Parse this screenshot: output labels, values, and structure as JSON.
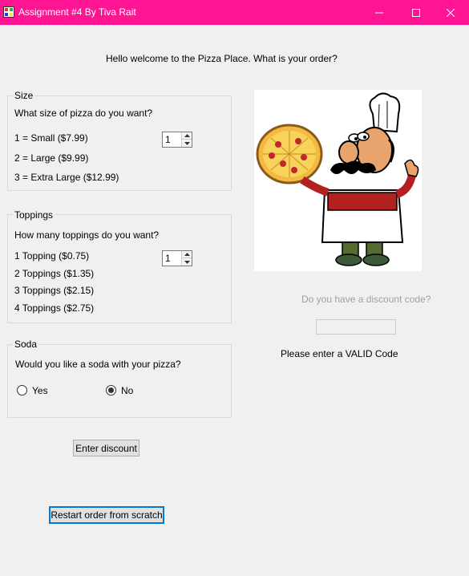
{
  "window": {
    "title": "Assignment #4 By Tiva Rait",
    "titlebar_color": "#ff1493",
    "icons": {
      "app": "app-icon",
      "minimize": "minimize-icon",
      "maximize": "maximize-icon",
      "close": "close-icon"
    }
  },
  "header": {
    "welcome": "Hello welcome to the Pizza Place. What is your order?"
  },
  "size": {
    "legend": "Size",
    "question": "What size of pizza do you want?",
    "options": [
      "1 = Small ($7.99)",
      "2 = Large ($9.99)",
      "3 = Extra Large ($12.99)"
    ],
    "spinner_value": "1"
  },
  "toppings": {
    "legend": "Toppings",
    "question": "How many toppings do you want?",
    "options": [
      "1 Topping ($0.75)",
      "2 Toppings ($1.35)",
      "3 Toppings ($2.15)",
      "4 Toppings ($2.75)"
    ],
    "spinner_value": "1"
  },
  "soda": {
    "legend": "Soda",
    "question": "Would you like a soda with your pizza?",
    "yes_label": "Yes",
    "no_label": "No",
    "selected": "No"
  },
  "discount": {
    "prompt": "Do you have a discount code?",
    "code_value": "",
    "message": "Please enter a VALID Code",
    "button_label": "Enter discount"
  },
  "restart_label": "Restart order from scratch",
  "illustration": "pizza-chef-image"
}
